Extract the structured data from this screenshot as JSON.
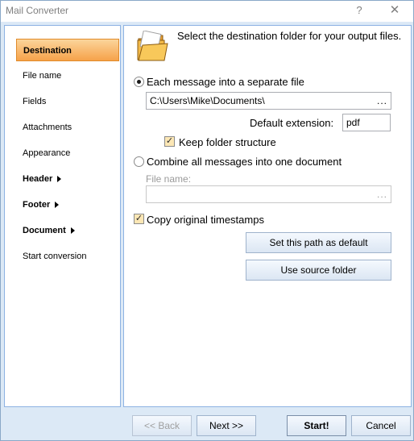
{
  "window": {
    "title": "Mail Converter",
    "help_glyph": "?",
    "close_glyph": "✕"
  },
  "sidebar": {
    "items": [
      {
        "label": "Destination"
      },
      {
        "label": "File name"
      },
      {
        "label": "Fields"
      },
      {
        "label": "Attachments"
      },
      {
        "label": "Appearance"
      },
      {
        "label": "Header"
      },
      {
        "label": "Footer"
      },
      {
        "label": "Document"
      },
      {
        "label": "Start conversion"
      }
    ]
  },
  "main": {
    "header_text": "Select the destination folder for your output files.",
    "radio_separate_label": "Each message into a separate file",
    "path_value": "C:\\Users\\Mike\\Documents\\",
    "browse_dots": "...",
    "default_ext_label": "Default extension:",
    "default_ext_value": "pdf",
    "keep_folder_label": "Keep folder structure",
    "radio_combine_label": "Combine all messages into one document",
    "file_name_label": "File name:",
    "file_name_value": "",
    "copy_timestamps_label": "Copy original timestamps",
    "set_default_button": "Set this path as default",
    "use_source_button": "Use source folder",
    "check_glyph": "✓"
  },
  "footer": {
    "back_button": "<< Back",
    "next_button": "Next >>",
    "start_button": "Start!",
    "cancel_button": "Cancel"
  },
  "icons": {
    "folder": "folder-icon"
  },
  "colors": {
    "accent_active": "#f6a24a",
    "window_bg": "#dce9f6",
    "panel_border": "#8db2e3"
  }
}
